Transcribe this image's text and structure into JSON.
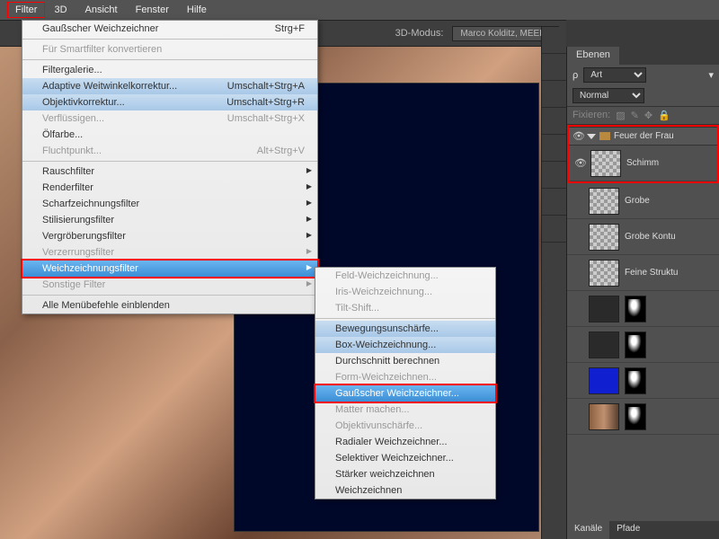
{
  "menubar": {
    "filter": "Filter",
    "threed": "3D",
    "ansicht": "Ansicht",
    "fenster": "Fenster",
    "hilfe": "Hilfe"
  },
  "toolstrip": {
    "mode": "3D-Modus:",
    "user": "Marco Kolditz, MEER I"
  },
  "filtermenu": {
    "last": "Gaußscher Weichzeichner",
    "last_sc": "Strg+F",
    "smart": "Für Smartfilter konvertieren",
    "gallery": "Filtergalerie...",
    "adaptive": "Adaptive Weitwinkelkorrektur...",
    "adaptive_sc": "Umschalt+Strg+A",
    "lens": "Objektivkorrektur...",
    "lens_sc": "Umschalt+Strg+R",
    "liquify": "Verflüssigen...",
    "liquify_sc": "Umschalt+Strg+X",
    "oil": "Ölfarbe...",
    "vanish": "Fluchtpunkt...",
    "vanish_sc": "Alt+Strg+V",
    "noise": "Rauschfilter",
    "render": "Renderfilter",
    "sharpen": "Scharfzeichnungsfilter",
    "stylize": "Stilisierungsfilter",
    "pixelate": "Vergröberungsfilter",
    "distort": "Verzerrungsfilter",
    "blur": "Weichzeichnungsfilter",
    "other": "Sonstige Filter",
    "showall": "Alle Menübefehle einblenden"
  },
  "blurmenu": {
    "field": "Feld-Weichzeichnung...",
    "iris": "Iris-Weichzeichnung...",
    "tilt": "Tilt-Shift...",
    "motion": "Bewegungsunschärfe...",
    "box": "Box-Weichzeichnung...",
    "avg": "Durchschnitt berechnen",
    "shape": "Form-Weichzeichnen...",
    "gauss": "Gaußscher Weichzeichner...",
    "matte": "Matter machen...",
    "lens": "Objektivunschärfe...",
    "radial": "Radialer Weichzeichner...",
    "smart": "Selektiver Weichzeichner...",
    "more": "Stärker weichzeichnen",
    "soft": "Weichzeichnen"
  },
  "panel": {
    "title": "Ebenen",
    "kind": "Art",
    "blend": "Normal",
    "lock": "Fixieren:",
    "group": "Feuer der Frau",
    "layers": [
      {
        "name": "Schimm"
      },
      {
        "name": "Grobe"
      },
      {
        "name": "Grobe Kontu"
      },
      {
        "name": "Feine Struktu"
      }
    ],
    "bottom1": "Kanäle",
    "bottom2": "Pfade"
  }
}
